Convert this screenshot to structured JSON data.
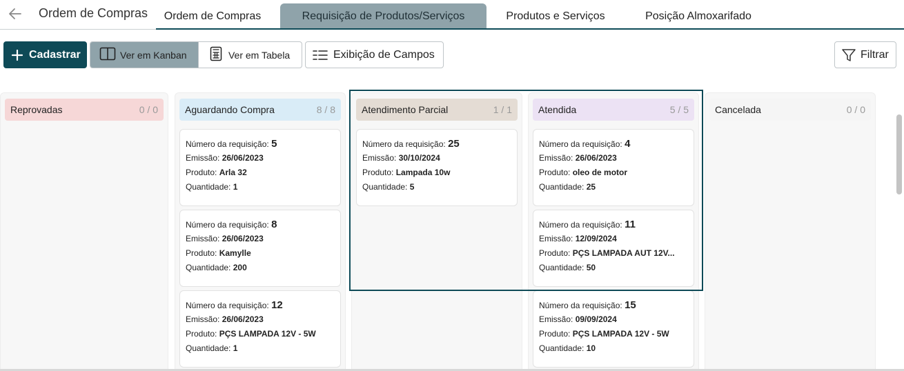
{
  "header": {
    "title": "Ordem de Compras",
    "tabs": [
      {
        "label": "Ordem de Compras"
      },
      {
        "label": "Requisição de Produtos/Serviços"
      },
      {
        "label": "Produtos e Serviços"
      },
      {
        "label": "Posição Almoxarifado"
      }
    ]
  },
  "toolbar": {
    "add_label": "Cadastrar",
    "kanban_label": "Ver em Kanban",
    "table_label": "Ver em Tabela",
    "fields_label": "Exibição de Campos",
    "filter_label": "Filtrar"
  },
  "colors": {
    "accent": "#0e4a57",
    "active_tab": "#8fa3aa"
  },
  "card_labels": {
    "number": "Número da requisição:",
    "issue": "Emissão:",
    "product": "Produto:",
    "quantity": "Quantidade:"
  },
  "columns": [
    {
      "title": "Reprovadas",
      "count": "0 / 0",
      "color": "#f6d7d7",
      "cards": []
    },
    {
      "title": "Aguardando Compra",
      "count": "8 / 8",
      "color": "#d9ecf7",
      "cards": [
        {
          "number": "5",
          "issue": "26/06/2023",
          "product": "Arla 32",
          "quantity": "1"
        },
        {
          "number": "8",
          "issue": "26/06/2023",
          "product": "Kamylle",
          "quantity": "200"
        },
        {
          "number": "12",
          "issue": "26/06/2023",
          "product": "PÇS LAMPADA 12V - 5W",
          "quantity": "1"
        }
      ]
    },
    {
      "title": "Atendimento Parcial",
      "count": "1 / 1",
      "color": "#e4dcd4",
      "cards": [
        {
          "number": "25",
          "issue": "30/10/2024",
          "product": "Lampada 10w",
          "quantity": "5"
        }
      ]
    },
    {
      "title": "Atendida",
      "count": "5 / 5",
      "color": "#ece2f4",
      "cards": [
        {
          "number": "4",
          "issue": "26/06/2023",
          "product": "oleo de motor",
          "quantity": "25"
        },
        {
          "number": "11",
          "issue": "12/09/2024",
          "product": "PÇS LAMPADA AUT 12V...",
          "quantity": "50"
        },
        {
          "number": "15",
          "issue": "09/09/2024",
          "product": "PÇS LAMPADA 12V - 5W",
          "quantity": "10"
        }
      ]
    },
    {
      "title": "Cancelada",
      "count": "0 / 0",
      "color": "#f5f5f5",
      "cards": []
    }
  ]
}
